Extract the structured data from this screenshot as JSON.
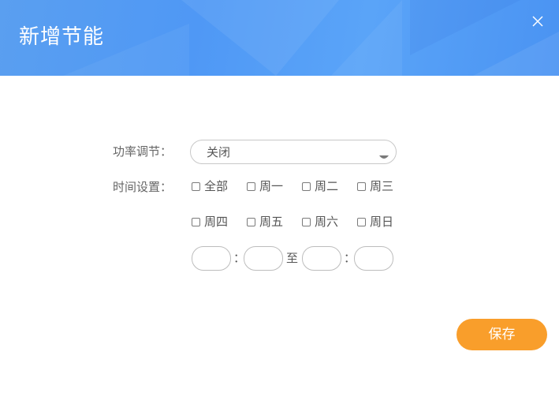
{
  "dialog": {
    "title": "新增节能",
    "close_icon": "close-icon"
  },
  "colors": {
    "header_blue": "#4f98f5",
    "save_orange": "#f99e2b"
  },
  "form": {
    "power_label": "功率调节：",
    "power_value": "关闭",
    "time_label": "时间设置：",
    "days": [
      "全部",
      "周一",
      "周二",
      "周三",
      "周四",
      "周五",
      "周六",
      "周日"
    ],
    "time_separator": "：",
    "time_to": "至",
    "start_hour": "",
    "start_minute": "",
    "end_hour": "",
    "end_minute": ""
  },
  "actions": {
    "save_label": "保存"
  }
}
